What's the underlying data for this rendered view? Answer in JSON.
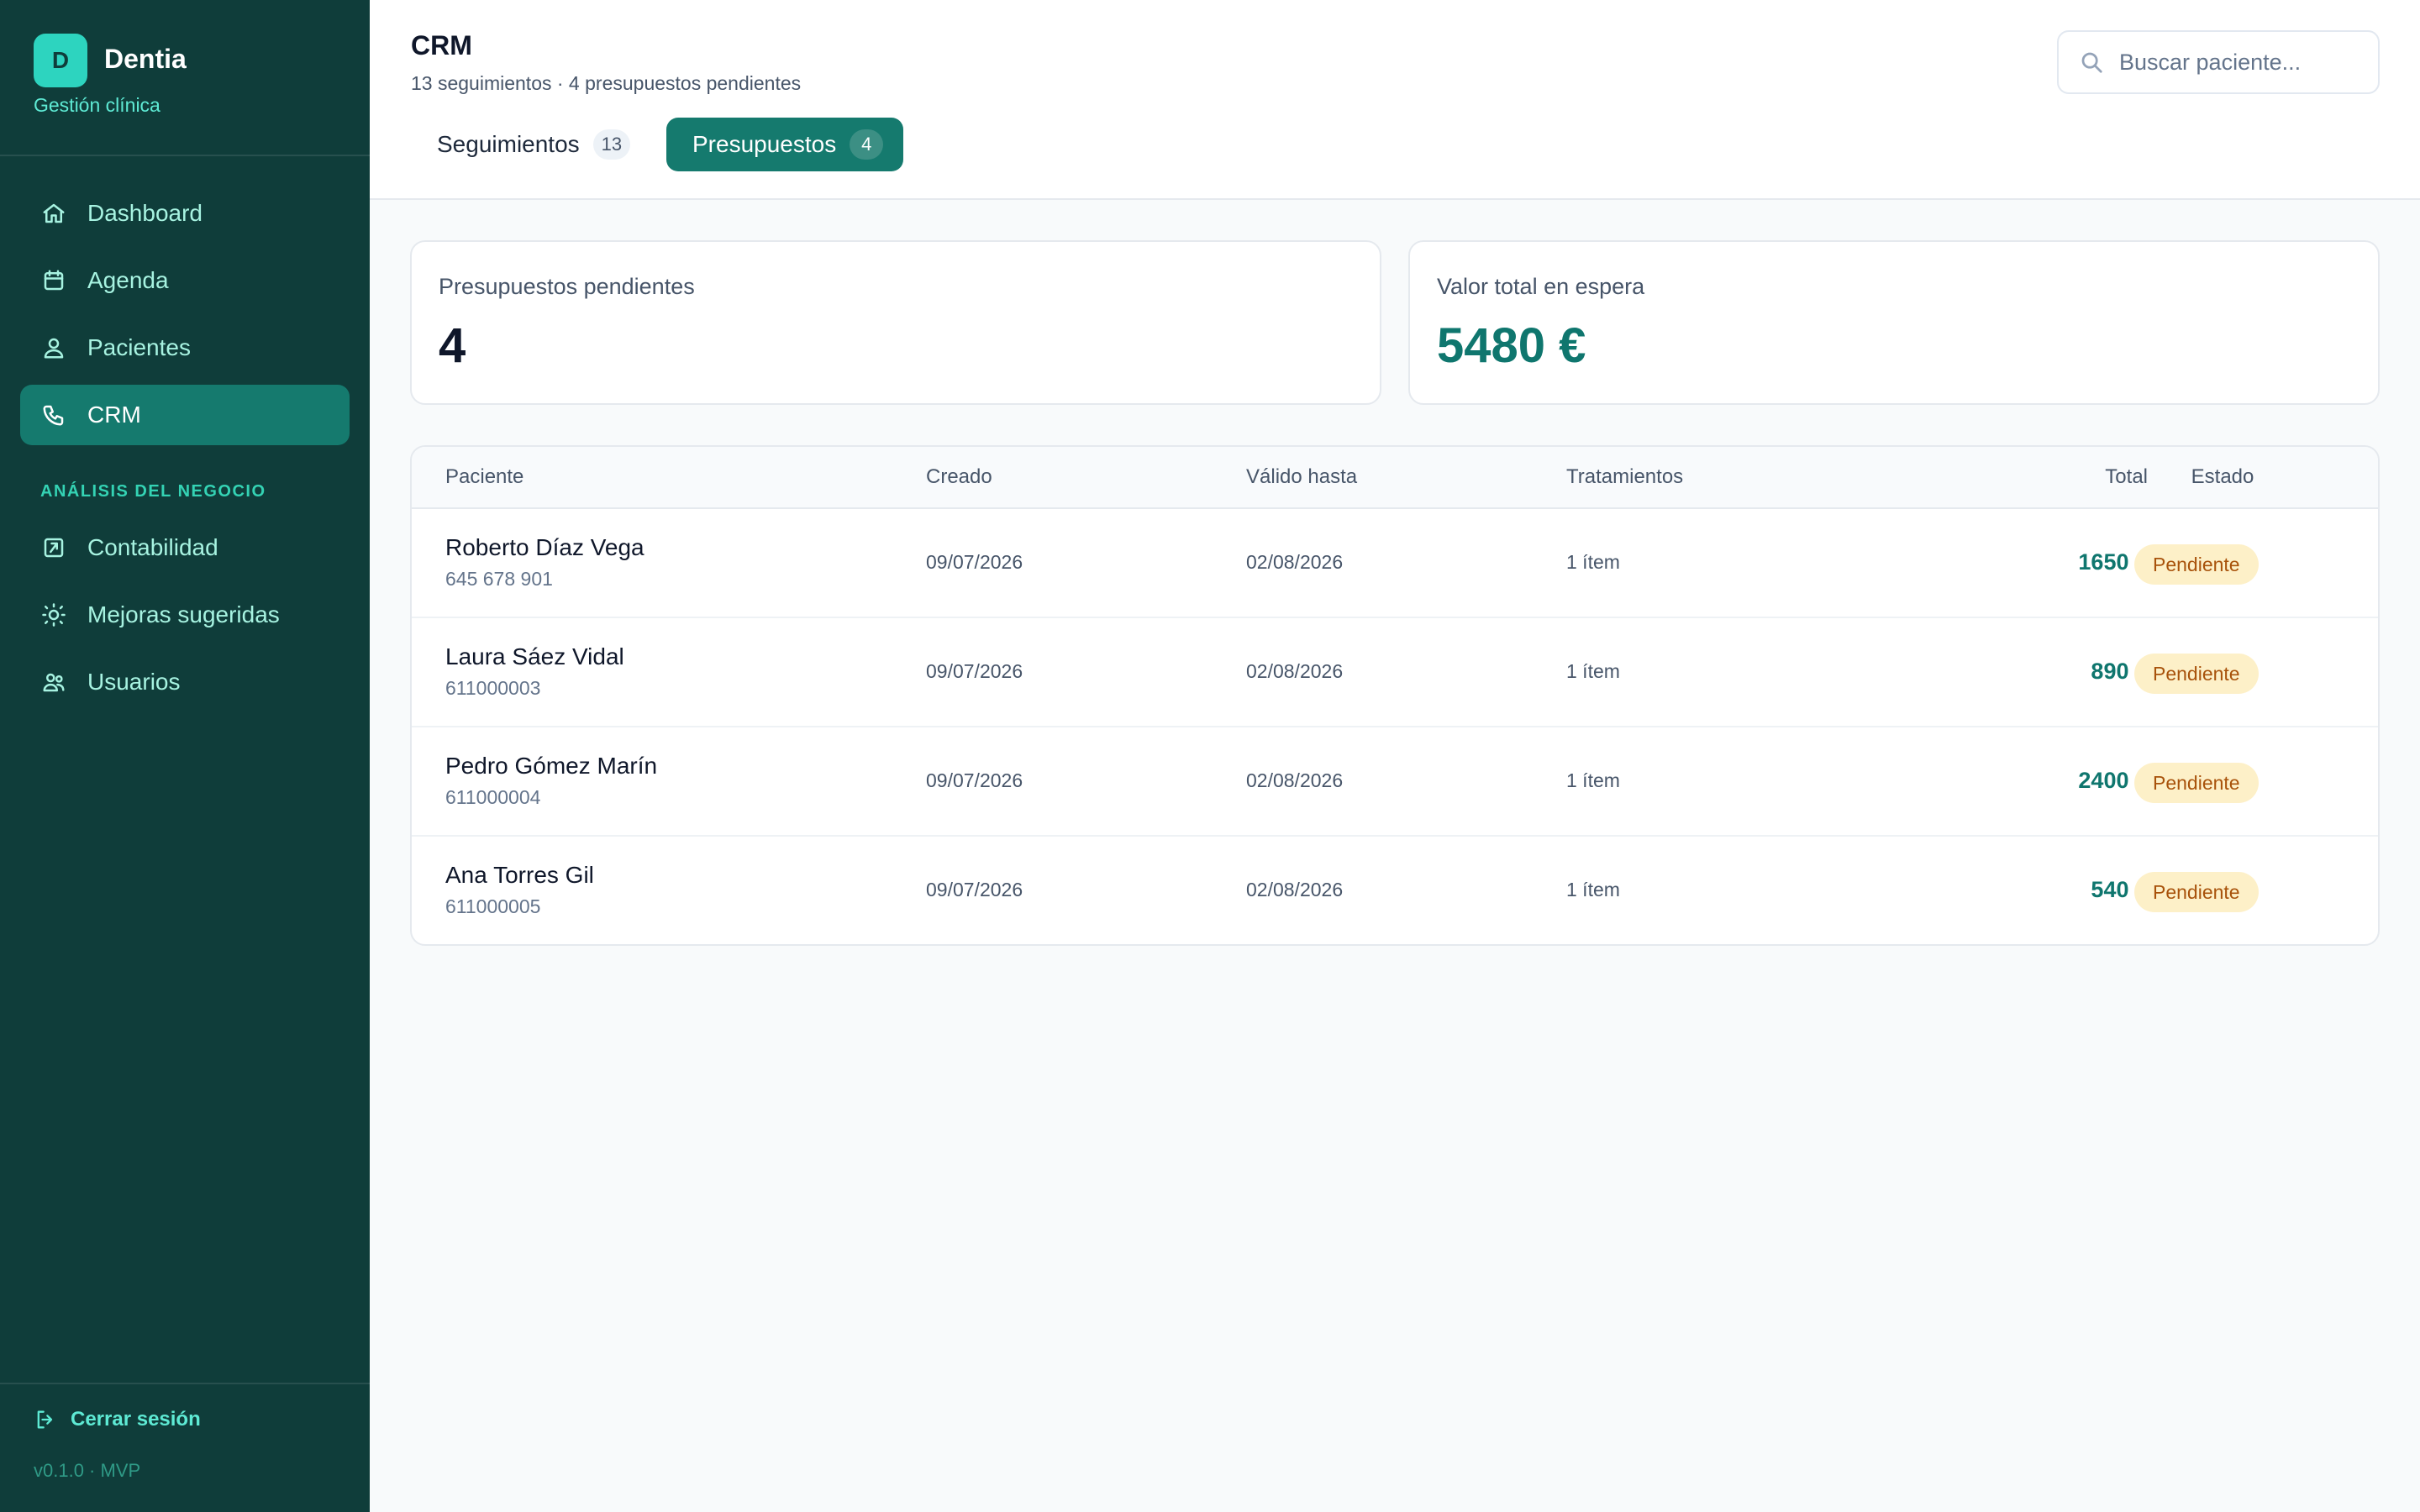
{
  "sidebar": {
    "brand": {
      "logo_letter": "D",
      "name": "Dentia",
      "subtitle": "Gestión clínica"
    },
    "nav": [
      {
        "label": "Dashboard",
        "icon": "home-icon",
        "active": false
      },
      {
        "label": "Agenda",
        "icon": "calendar-icon",
        "active": false
      },
      {
        "label": "Pacientes",
        "icon": "users-icon",
        "active": false
      },
      {
        "label": "CRM",
        "icon": "phone-icon",
        "active": true
      }
    ],
    "section_label": "ANÁLISIS DEL NEGOCIO",
    "business_nav": [
      {
        "label": "Contabilidad",
        "icon": "chart-square-icon"
      },
      {
        "label": "Mejoras sugeridas",
        "icon": "lightbulb-icon"
      },
      {
        "label": "Usuarios",
        "icon": "team-icon"
      }
    ],
    "logout_label": "Cerrar sesión",
    "version": "v0.1.0 · MVP"
  },
  "header": {
    "title": "CRM",
    "subtitle": "13 seguimientos · 4 presupuestos pendientes",
    "tabs": [
      {
        "label": "Seguimientos",
        "count": "13",
        "active": false
      },
      {
        "label": "Presupuestos",
        "count": "4",
        "active": true
      }
    ],
    "search": {
      "placeholder": "Buscar paciente...",
      "value": ""
    }
  },
  "stats": [
    {
      "label": "Presupuestos pendientes",
      "value": "4"
    },
    {
      "label": "Valor total en espera",
      "value": "5480 €"
    }
  ],
  "table": {
    "columns": [
      "Paciente",
      "Creado",
      "Válido hasta",
      "Tratamientos",
      "Total",
      "Estado"
    ],
    "rows": [
      {
        "name": "Roberto Díaz Vega",
        "phone": "645 678 901",
        "created": "09/07/2026",
        "valid_until": "02/08/2026",
        "treatments": "1 ítem",
        "total": "1650 €",
        "status": "Pendiente"
      },
      {
        "name": "Laura Sáez Vidal",
        "phone": "611000003",
        "created": "09/07/2026",
        "valid_until": "02/08/2026",
        "treatments": "1 ítem",
        "total": "890 €",
        "status": "Pendiente"
      },
      {
        "name": "Pedro Gómez Marín",
        "phone": "611000004",
        "created": "09/07/2026",
        "valid_until": "02/08/2026",
        "treatments": "1 ítem",
        "total": "2400 €",
        "status": "Pendiente"
      },
      {
        "name": "Ana Torres Gil",
        "phone": "611000005",
        "created": "09/07/2026",
        "valid_until": "02/08/2026",
        "treatments": "1 ítem",
        "total": "540 €",
        "status": "Pendiente"
      }
    ]
  },
  "colors": {
    "sidebar_bg": "#0f3d3a",
    "accent": "#157a6e",
    "accent_text": "#0f766e",
    "badge_bg": "#fdf0c8",
    "badge_text": "#a8520b"
  }
}
